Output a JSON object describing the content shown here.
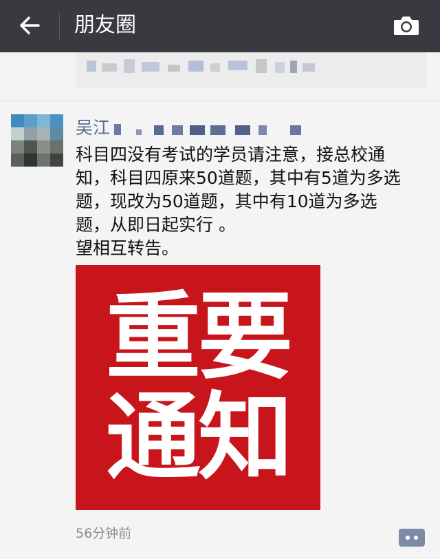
{
  "header": {
    "title": "朋友圈",
    "background": "#393a3f"
  },
  "post": {
    "author": "吴江",
    "text_lines": [
      "科目四没有考试的学员请注意，接总校通",
      "知，科目四原来50道题，其中有5道为多选",
      "题，现改为50道题，其中有10道为多选",
      "题，从即日起实行 。",
      "望相互转告。"
    ],
    "image_text_line1": "重要",
    "image_text_line2": "通知",
    "image_background": "#c8141b",
    "timestamp": "56分钟前"
  },
  "icons": {
    "back": "back-arrow-icon",
    "camera": "camera-icon",
    "comment": "comment-icon"
  },
  "colors": {
    "link_name": "#576b95",
    "comment_button": "#7b8aa6"
  }
}
